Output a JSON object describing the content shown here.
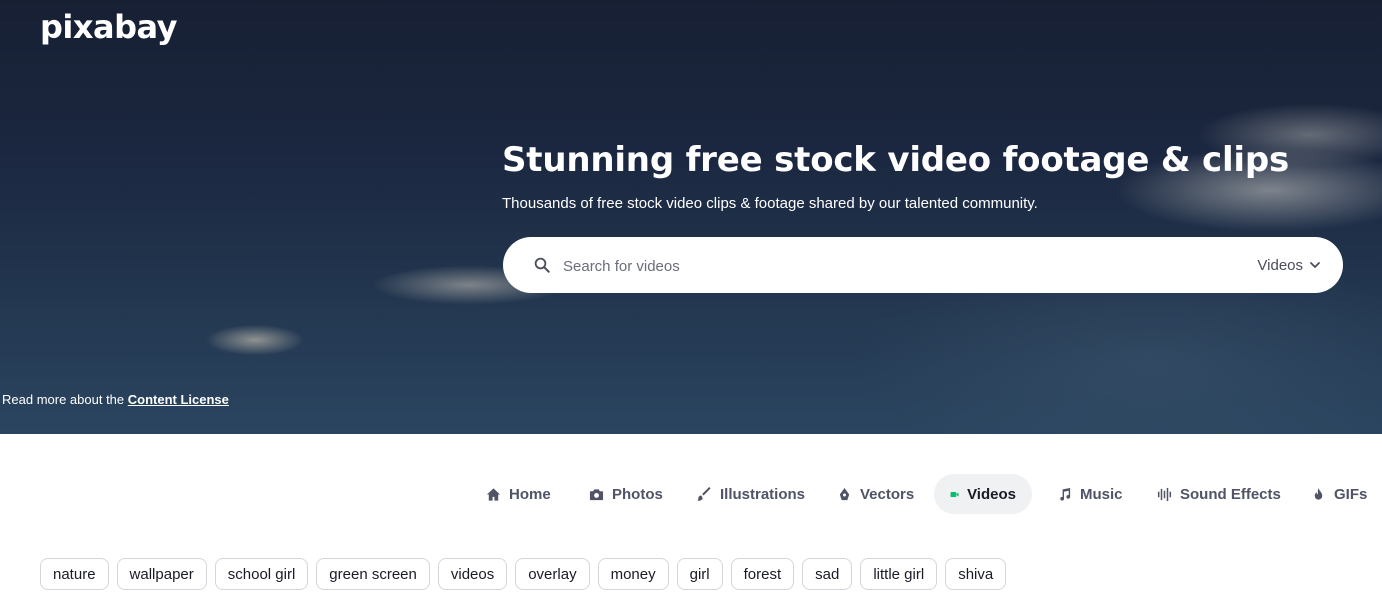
{
  "brand": {
    "logo_text": "pixabay"
  },
  "hero": {
    "title": "Stunning free stock video footage & clips",
    "subtitle": "Thousands of free stock video clips & footage shared by our talented community."
  },
  "search": {
    "placeholder": "Search for videos",
    "value": "",
    "type_selected": "Videos"
  },
  "license": {
    "prefix": "Read more about the",
    "link_text": "Content License"
  },
  "nav": {
    "items": [
      {
        "label": "Home",
        "icon": "home-icon"
      },
      {
        "label": "Photos",
        "icon": "camera-icon"
      },
      {
        "label": "Illustrations",
        "icon": "brush-icon"
      },
      {
        "label": "Vectors",
        "icon": "pen-tool-icon"
      },
      {
        "label": "Videos",
        "icon": "video-camera-icon",
        "active": true
      },
      {
        "label": "Music",
        "icon": "music-note-icon"
      },
      {
        "label": "Sound Effects",
        "icon": "sound-wave-icon"
      },
      {
        "label": "GIFs",
        "icon": "flame-icon"
      }
    ],
    "active_color": "#02be6e"
  },
  "tags": [
    "nature",
    "wallpaper",
    "school girl",
    "green screen",
    "videos",
    "overlay",
    "money",
    "girl",
    "forest",
    "sad",
    "little girl",
    "shiva"
  ]
}
